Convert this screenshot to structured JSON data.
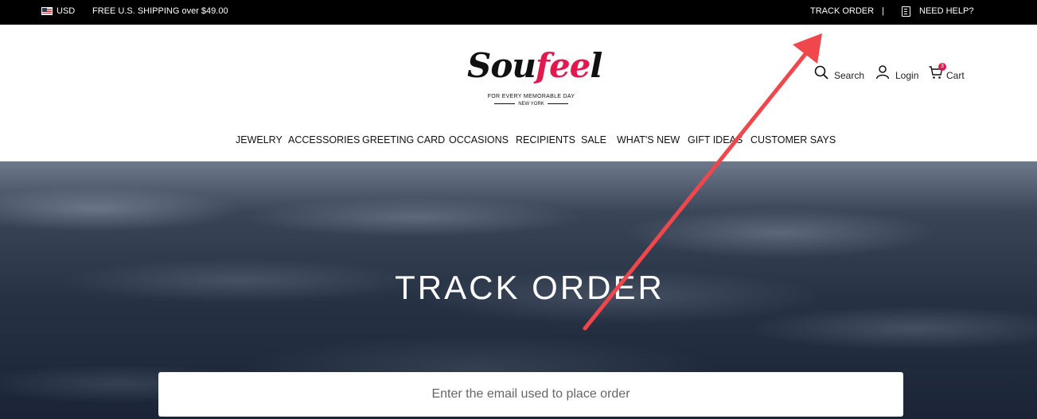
{
  "topbar": {
    "currency": "USD",
    "shipping": "FREE U.S. SHIPPING over $49.00",
    "track_order": "TRACK ORDER",
    "separator": "|",
    "help": "NEED HELP?"
  },
  "brand": {
    "logo_text_a": "Sou",
    "logo_text_b": "fee",
    "logo_text_c": "l",
    "tagline": "FOR EVERY MEMORABLE DAY",
    "location": "NEW YORK",
    "accent_color": "#e0194f"
  },
  "header": {
    "search_label": "Search",
    "login_label": "Login",
    "cart_label": "Cart",
    "cart_count": "3"
  },
  "nav": {
    "items": [
      {
        "label": "JEWELRY"
      },
      {
        "label": "ACCESSORIES"
      },
      {
        "label": "GREETING CARD"
      },
      {
        "label": "OCCASIONS"
      },
      {
        "label": "RECIPIENTS"
      },
      {
        "label": "SALE"
      },
      {
        "label": "WHAT'S NEW"
      },
      {
        "label": "GIFT IDEAS"
      },
      {
        "label": "CUSTOMER SAYS"
      }
    ]
  },
  "hero": {
    "title": "TRACK ORDER",
    "email_placeholder": "Enter the email used to place order",
    "email_value": ""
  },
  "annotation": {
    "arrow_color": "#f0474d"
  }
}
